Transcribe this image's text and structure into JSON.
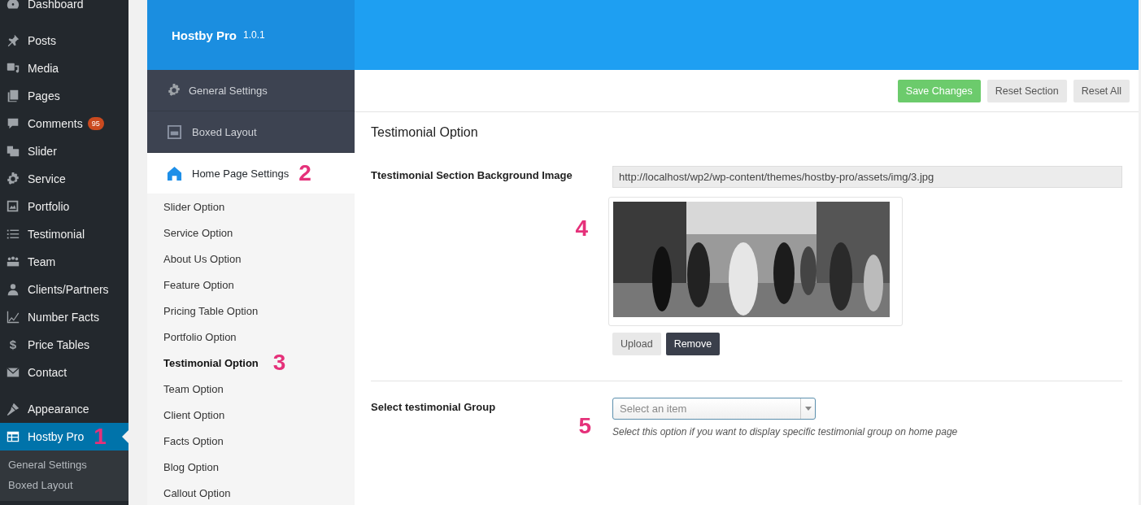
{
  "admin_menu": {
    "groups": [
      [
        {
          "label": "Dashboard",
          "selected": false
        }
      ],
      [
        {
          "label": "Posts",
          "selected": false
        },
        {
          "label": "Media",
          "selected": false
        },
        {
          "label": "Pages",
          "selected": false
        },
        {
          "label": "Comments",
          "selected": false,
          "badge": "95"
        },
        {
          "label": "Slider",
          "selected": false
        },
        {
          "label": "Service",
          "selected": false
        },
        {
          "label": "Portfolio",
          "selected": false
        },
        {
          "label": "Testimonial",
          "selected": false
        },
        {
          "label": "Team",
          "selected": false
        },
        {
          "label": "Clients/Partners",
          "selected": false
        },
        {
          "label": "Number Facts",
          "selected": false
        },
        {
          "label": "Price Tables",
          "glyph": "$",
          "selected": false
        },
        {
          "label": "Contact",
          "selected": false
        }
      ],
      [
        {
          "label": "Appearance",
          "selected": false
        },
        {
          "label": "Hostby Pro",
          "selected": true,
          "marker": "1"
        }
      ]
    ],
    "submenu": [
      "General Settings",
      "Boxed Layout"
    ]
  },
  "panel": {
    "title": "Hostby Pro",
    "version": "1.0.1",
    "sections": [
      {
        "label": "General Settings",
        "selected": false
      },
      {
        "label": "Boxed Layout",
        "selected": false
      },
      {
        "label": "Home Page Settings",
        "selected": true,
        "marker": "2",
        "children": [
          {
            "label": "Slider Option",
            "selected": false
          },
          {
            "label": "Service Option",
            "selected": false
          },
          {
            "label": "About Us Option",
            "selected": false
          },
          {
            "label": "Feature Option",
            "selected": false
          },
          {
            "label": "Pricing Table Option",
            "selected": false
          },
          {
            "label": "Portfolio Option",
            "selected": false
          },
          {
            "label": "Testimonial Option",
            "selected": true,
            "marker": "3"
          },
          {
            "label": "Team Option",
            "selected": false
          },
          {
            "label": "Client Option",
            "selected": false
          },
          {
            "label": "Facts Option",
            "selected": false
          },
          {
            "label": "Blog Option",
            "selected": false
          },
          {
            "label": "Callout Option",
            "selected": false
          }
        ]
      }
    ]
  },
  "toolbar": {
    "buttons": [
      {
        "label": "Save Changes",
        "kind": "primary"
      },
      {
        "label": "Reset Section",
        "kind": "default"
      },
      {
        "label": "Reset All",
        "kind": "default"
      }
    ]
  },
  "section": {
    "title": "Testimonial Option",
    "fields": [
      {
        "kind": "media",
        "label": "Ttestimonial Section Background Image",
        "value": "http://localhost/wp2/wp-content/themes/hostby-pro/assets/img/3.jpg",
        "marker": "4",
        "buttons": [
          {
            "label": "Upload",
            "kind": "default"
          },
          {
            "label": "Remove",
            "kind": "dark"
          }
        ]
      },
      {
        "kind": "select",
        "label": "Select testimonial Group",
        "placeholder": "Select an item",
        "marker": "5",
        "description": "Select this option if you want to display specific testimonial group on home page"
      }
    ]
  }
}
